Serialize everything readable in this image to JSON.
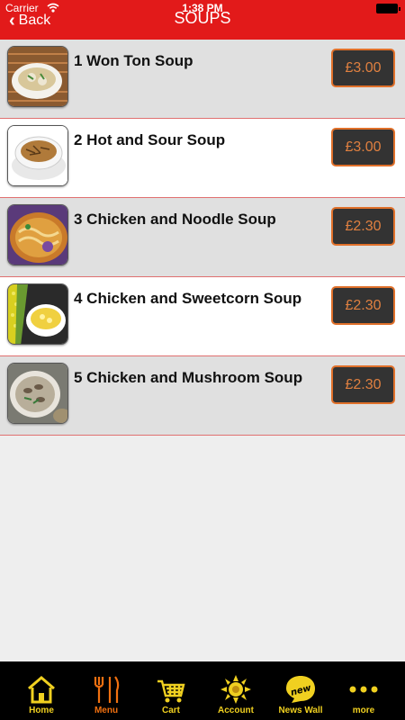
{
  "status_bar": {
    "carrier": "Carrier",
    "time": "1:38 PM"
  },
  "header": {
    "back_label": "Back",
    "title": "SOUPS"
  },
  "items": [
    {
      "name": "1 Won Ton Soup",
      "price": "£3.00"
    },
    {
      "name": "2 Hot and Sour Soup",
      "price": "£3.00"
    },
    {
      "name": "3 Chicken and Noodle Soup",
      "price": "£2.30"
    },
    {
      "name": "4 Chicken and Sweetcorn Soup",
      "price": "£2.30"
    },
    {
      "name": "5 Chicken and Mushroom Soup",
      "price": "£2.30"
    }
  ],
  "tabs": [
    {
      "label": "Home",
      "icon": "home-icon"
    },
    {
      "label": "Menu",
      "icon": "fork-knife-icon",
      "active": true
    },
    {
      "label": "Cart",
      "icon": "cart-icon"
    },
    {
      "label": "Account",
      "icon": "sun-icon"
    },
    {
      "label": "News Wall",
      "icon": "new-badge-icon",
      "badge": "new"
    },
    {
      "label": "more",
      "icon": "more-dots-icon"
    }
  ],
  "colors": {
    "header": "#e21a1a",
    "price_border": "#e0702a",
    "tab_label": "#f0d020",
    "tab_active": "#f07010"
  }
}
